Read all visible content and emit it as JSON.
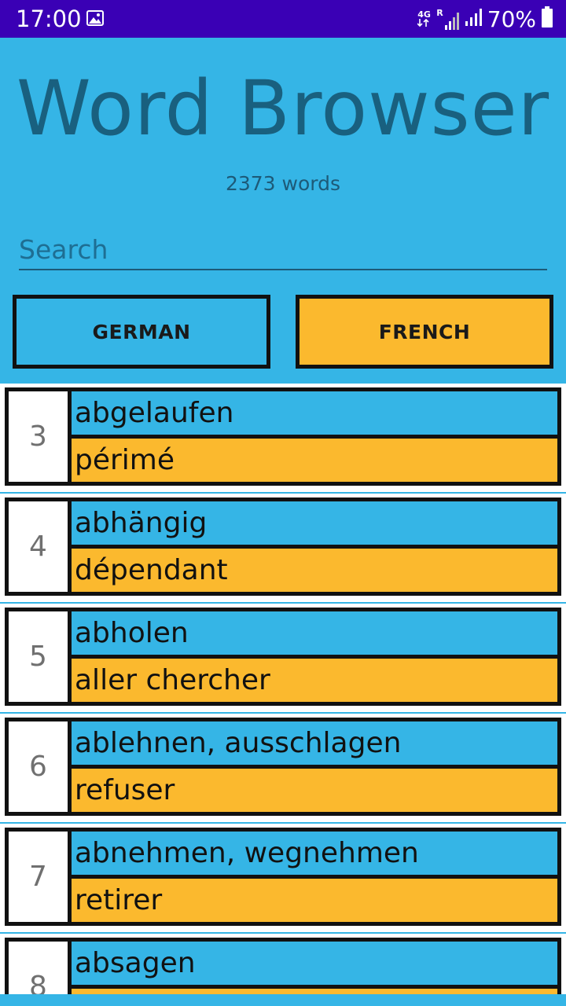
{
  "status_bar": {
    "time": "17:00",
    "network_label": "4G",
    "roaming_label": "R",
    "battery_pct": "70%"
  },
  "header": {
    "title": "Word Browser",
    "count": "2373 words"
  },
  "search": {
    "placeholder": "Search",
    "value": ""
  },
  "buttons": {
    "german": "GERMAN",
    "french": "FRENCH"
  },
  "colors": {
    "german": "#35b5e6",
    "french": "#fbb92e",
    "statusbar": "#3a00b5"
  },
  "entries": [
    {
      "num": "3",
      "german": "abgelaufen",
      "french": "périmé"
    },
    {
      "num": "4",
      "german": "abhängig",
      "french": "dépendant"
    },
    {
      "num": "5",
      "german": "abholen",
      "french": "aller chercher"
    },
    {
      "num": "6",
      "german": "ablehnen, ausschlagen",
      "french": "refuser"
    },
    {
      "num": "7",
      "german": "abnehmen, wegnehmen",
      "french": "retirer"
    },
    {
      "num": "8",
      "german": "absagen",
      "french": ""
    }
  ]
}
